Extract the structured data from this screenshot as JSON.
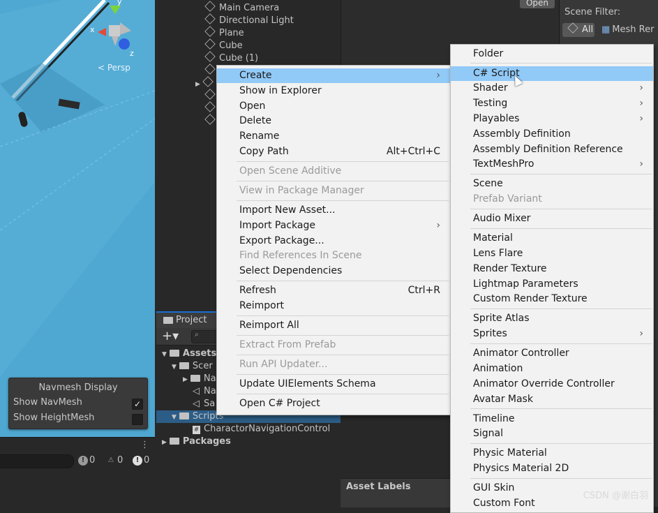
{
  "scene": {
    "view_label": "< Persp",
    "axis_x": "x",
    "axis_z": "z",
    "axis_y": "y",
    "navmesh": {
      "title": "Navmesh Display",
      "rows": [
        {
          "label": "Show NavMesh",
          "checked": true
        },
        {
          "label": "Show HeightMesh",
          "checked": false
        }
      ]
    }
  },
  "console": {
    "errors": "0",
    "warnings": "0",
    "messages": "0"
  },
  "hierarchy": {
    "items": [
      "Main Camera",
      "Directional Light",
      "Plane",
      "Cube",
      "Cube (1)"
    ]
  },
  "inspector": {
    "open_label": "Open"
  },
  "scene_filter": {
    "label": "Scene Filter:",
    "all_label": "All",
    "mesh_label": "Mesh Rer"
  },
  "project": {
    "tab_label": "Project",
    "add_label": "+▾",
    "tree": [
      {
        "label": "Assets",
        "indent": 0
      },
      {
        "label": "Scer",
        "indent": 1
      },
      {
        "label": "Na",
        "indent": 2
      },
      {
        "label": "Na",
        "indent": 2
      },
      {
        "label": "Sa",
        "indent": 2
      },
      {
        "label": "Scripts",
        "indent": 1
      },
      {
        "label": "CharactorNavigationControl",
        "indent": 2
      },
      {
        "label": "Packages",
        "indent": 0
      }
    ]
  },
  "asset_labels": "Asset Labels",
  "context_menu": {
    "groups": [
      [
        {
          "label": "Create",
          "highlighted": true,
          "submenu": true
        },
        {
          "label": "Show in Explorer"
        },
        {
          "label": "Open"
        },
        {
          "label": "Delete"
        },
        {
          "label": "Rename"
        },
        {
          "label": "Copy Path",
          "shortcut": "Alt+Ctrl+C"
        }
      ],
      [
        {
          "label": "Open Scene Additive",
          "disabled": true
        }
      ],
      [
        {
          "label": "View in Package Manager",
          "disabled": true
        }
      ],
      [
        {
          "label": "Import New Asset..."
        },
        {
          "label": "Import Package",
          "submenu": true
        },
        {
          "label": "Export Package..."
        },
        {
          "label": "Find References In Scene",
          "disabled": true
        },
        {
          "label": "Select Dependencies"
        }
      ],
      [
        {
          "label": "Refresh",
          "shortcut": "Ctrl+R"
        },
        {
          "label": "Reimport"
        }
      ],
      [
        {
          "label": "Reimport All"
        }
      ],
      [
        {
          "label": "Extract From Prefab",
          "disabled": true
        }
      ],
      [
        {
          "label": "Run API Updater...",
          "disabled": true
        }
      ],
      [
        {
          "label": "Update UIElements Schema"
        }
      ],
      [
        {
          "label": "Open C# Project"
        }
      ]
    ]
  },
  "create_submenu": {
    "groups": [
      [
        {
          "label": "Folder"
        }
      ],
      [
        {
          "label": "C# Script",
          "highlighted": true
        },
        {
          "label": "Shader",
          "submenu": true
        },
        {
          "label": "Testing",
          "submenu": true
        },
        {
          "label": "Playables",
          "submenu": true
        },
        {
          "label": "Assembly Definition"
        },
        {
          "label": "Assembly Definition Reference"
        },
        {
          "label": "TextMeshPro",
          "submenu": true
        }
      ],
      [
        {
          "label": "Scene"
        },
        {
          "label": "Prefab Variant",
          "disabled": true
        }
      ],
      [
        {
          "label": "Audio Mixer"
        }
      ],
      [
        {
          "label": "Material"
        },
        {
          "label": "Lens Flare"
        },
        {
          "label": "Render Texture"
        },
        {
          "label": "Lightmap Parameters"
        },
        {
          "label": "Custom Render Texture"
        }
      ],
      [
        {
          "label": "Sprite Atlas"
        },
        {
          "label": "Sprites",
          "submenu": true
        }
      ],
      [
        {
          "label": "Animator Controller"
        },
        {
          "label": "Animation"
        },
        {
          "label": "Animator Override Controller"
        },
        {
          "label": "Avatar Mask"
        }
      ],
      [
        {
          "label": "Timeline"
        },
        {
          "label": "Signal"
        }
      ],
      [
        {
          "label": "Physic Material"
        },
        {
          "label": "Physics Material 2D"
        }
      ],
      [
        {
          "label": "GUI Skin"
        },
        {
          "label": "Custom Font"
        }
      ]
    ]
  },
  "watermark": "CSDN @谢白羽"
}
